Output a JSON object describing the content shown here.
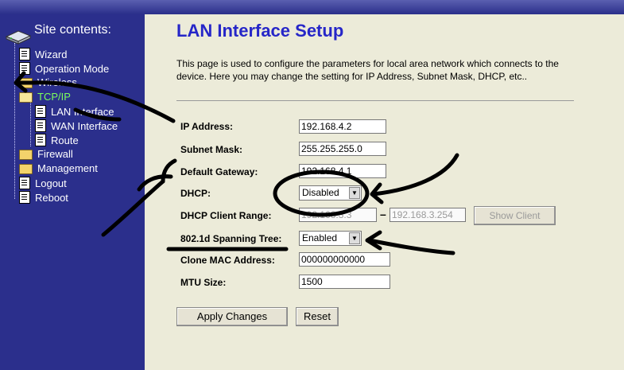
{
  "sidebar": {
    "title": "Site contents:",
    "items": [
      {
        "label": "Wizard"
      },
      {
        "label": "Operation Mode"
      },
      {
        "label": "Wireless"
      },
      {
        "label": "TCP/IP"
      },
      {
        "label": "LAN Interface"
      },
      {
        "label": "WAN Interface"
      },
      {
        "label": "Route"
      },
      {
        "label": "Firewall"
      },
      {
        "label": "Management"
      },
      {
        "label": "Logout"
      },
      {
        "label": "Reboot"
      }
    ]
  },
  "page": {
    "title": "LAN Interface Setup",
    "description": "This page is used to configure the parameters for local area network which connects to the device. Here you may change the setting for IP Address, Subnet Mask, DHCP, etc..",
    "fields": {
      "ip_label": "IP Address:",
      "ip_value": "192.168.4.2",
      "mask_label": "Subnet Mask:",
      "mask_value": "255.255.255.0",
      "gateway_label": "Default Gateway:",
      "gateway_value": "192.168.4.1",
      "dhcp_label": "DHCP:",
      "dhcp_value": "Disabled",
      "range_label": "DHCP Client Range:",
      "range_start": "192.168.3.3",
      "range_dash": "–",
      "range_end": "192.168.3.254",
      "show_client": "Show Client",
      "stp_label": "802.1d Spanning Tree:",
      "stp_value": "Enabled",
      "mac_label": "Clone MAC Address:",
      "mac_value": "000000000000",
      "mtu_label": "MTU Size:",
      "mtu_value": "1500"
    },
    "buttons": {
      "apply": "Apply Changes",
      "reset": "Reset"
    }
  },
  "colors": {
    "sidebar_bg": "#2b2f8c",
    "title_blue": "#2626c8",
    "active_green": "#7cff5c",
    "page_bg": "#ecebd9"
  },
  "icons": [
    "site-logo-icon",
    "folder-icon",
    "page-icon"
  ]
}
